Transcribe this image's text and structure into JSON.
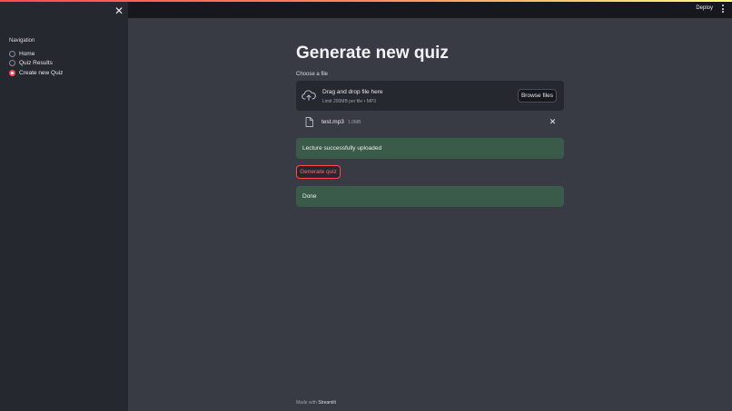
{
  "sidebar": {
    "close_glyph": "✕",
    "nav_title": "Navigation",
    "items": [
      {
        "label": "Home",
        "selected": false
      },
      {
        "label": "Quiz Results",
        "selected": false
      },
      {
        "label": "Create new Quiz",
        "selected": true
      }
    ]
  },
  "header": {
    "deploy_label": "Deploy",
    "menu_icon": "kebab-menu-icon"
  },
  "main": {
    "title": "Generate new quiz",
    "uploader": {
      "label": "Choose a file",
      "drop_title": "Drag and drop file here",
      "limit_text": "Limit 200MB per file • MP3",
      "browse_label": "Browse files",
      "icon": "cloud-upload-icon"
    },
    "file": {
      "name": "test.mp3",
      "size": "1.0MB",
      "remove_glyph": "✕",
      "icon": "file-icon"
    },
    "upload_alert": "Lecture successfully uploaded",
    "generate_button": "Generate quiz",
    "done_alert": "Done"
  },
  "footer": {
    "prefix": "Made with",
    "brand": "Streamlit"
  },
  "colors": {
    "accent": "#ff4b4b",
    "sidebar_bg": "#262830",
    "main_bg": "#393b44",
    "header_bg": "#17181d",
    "success_bg": "#3a5a4a"
  }
}
